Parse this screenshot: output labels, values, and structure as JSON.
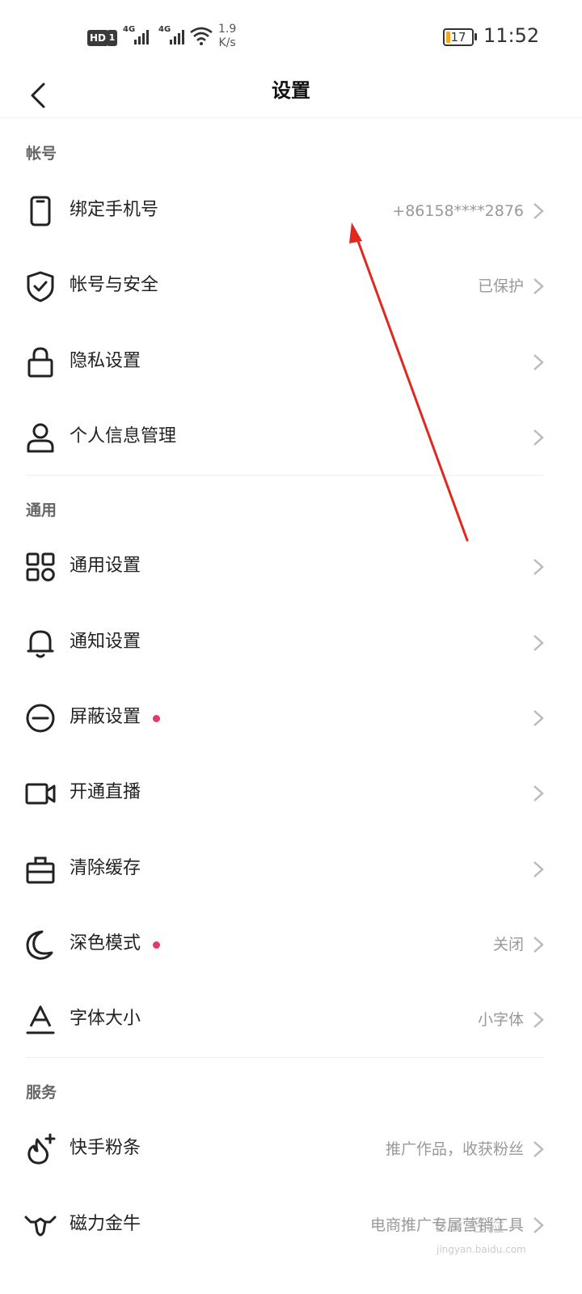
{
  "status_bar": {
    "hd": "HD",
    "sim": "1",
    "net1": "4G",
    "net2": "4G",
    "speed_value": "1.9",
    "speed_unit": "K/s",
    "battery": "17",
    "time": "11:52"
  },
  "nav": {
    "title": "设置",
    "back_icon": "chevron-left-icon"
  },
  "sections": {
    "account": {
      "header": "帐号",
      "items": [
        {
          "label": "绑定手机号",
          "value": "+86158****2876",
          "icon": "phone-icon"
        },
        {
          "label": "帐号与安全",
          "value": "已保护",
          "icon": "shield-check-icon"
        },
        {
          "label": "隐私设置",
          "value": "",
          "icon": "lock-icon"
        },
        {
          "label": "个人信息管理",
          "value": "",
          "icon": "person-icon"
        }
      ]
    },
    "general": {
      "header": "通用",
      "items": [
        {
          "label": "通用设置",
          "value": "",
          "icon": "grid-icon"
        },
        {
          "label": "通知设置",
          "value": "",
          "icon": "bell-icon"
        },
        {
          "label": "屏蔽设置",
          "value": "",
          "icon": "block-icon",
          "badge_dot": true
        },
        {
          "label": "开通直播",
          "value": "",
          "icon": "video-camera-icon"
        },
        {
          "label": "清除缓存",
          "value": "",
          "icon": "toolbox-icon"
        },
        {
          "label": "深色模式",
          "value": "关闭",
          "icon": "moon-icon",
          "badge_dot": true
        },
        {
          "label": "字体大小",
          "value": "小字体",
          "icon": "font-size-icon"
        }
      ]
    },
    "services": {
      "header": "服务",
      "items": [
        {
          "label": "快手粉条",
          "value": "推广作品，收获粉丝",
          "icon": "flame-plus-icon"
        },
        {
          "label": "磁力金牛",
          "value": "电商推广专属营销工具",
          "icon": "bull-icon"
        }
      ]
    }
  },
  "colors": {
    "badge_dot": "#e5386b",
    "annotation_arrow": "#e0281e"
  },
  "watermark": {
    "main": "Bai 经验",
    "sub": "jingyan.baidu.com"
  }
}
